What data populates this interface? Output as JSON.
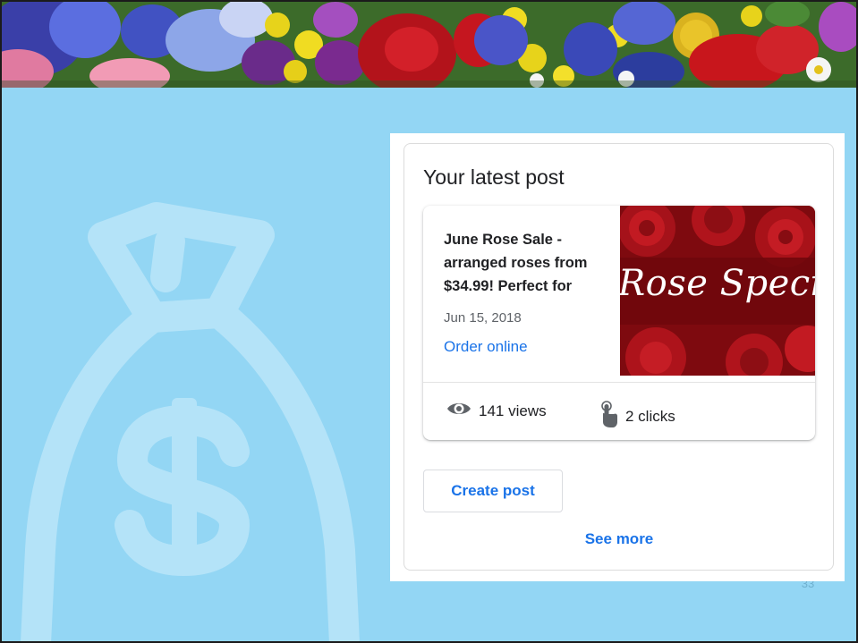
{
  "card": {
    "title": "Your latest post"
  },
  "post": {
    "text": "June Rose Sale - arranged roses from $34.99! Perfect for",
    "date": "Jun 15, 2018",
    "link_label": "Order online",
    "image_caption": "Rose Specia"
  },
  "stats": {
    "views": "141 views",
    "clicks": "2 clicks",
    "views_icon": "eye-icon",
    "clicks_icon": "pointer-hand-icon"
  },
  "actions": {
    "create_label": "Create post",
    "see_more_label": "See more"
  },
  "slide": {
    "number": "33"
  },
  "colors": {
    "background": "#93d6f4",
    "accent_link": "#1a73e8",
    "money_bag": "#b4e3f8",
    "rose_red": "#b3131b"
  }
}
